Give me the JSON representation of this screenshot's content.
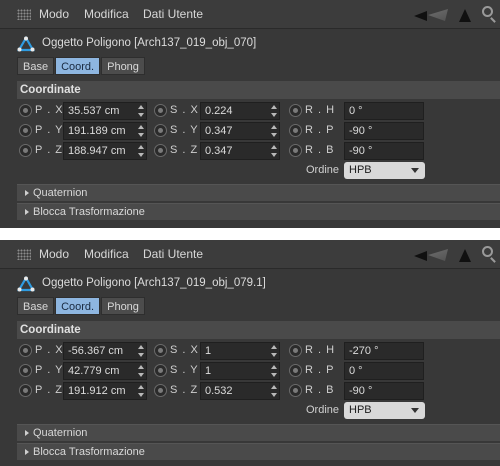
{
  "menubar": {
    "items": [
      "Modo",
      "Modifica",
      "Dati Utente"
    ]
  },
  "tabs": [
    "Base",
    "Coord.",
    "Phong"
  ],
  "active_tab": "Coord.",
  "section_title": "Coordinate",
  "order_label": "Ordine",
  "collapsibles": [
    "Quaternion",
    "Blocca Trasformazione"
  ],
  "colors": {
    "panel": "#383838",
    "active_tab": "#8eb6e0",
    "field": "#2a2a2a",
    "icon_accent": "#2e9be0"
  },
  "icons": [
    "grip-icon",
    "nav-back-icon",
    "nav-forward-icon",
    "nav-up-icon",
    "search-icon",
    "polygon-object-icon"
  ],
  "panels": [
    {
      "object_title": "Oggetto Poligono [Arch137_019_obj_070]",
      "rows": [
        {
          "p_label": "P . X",
          "p_value": "35.537 cm",
          "s_label": "S . X",
          "s_value": "0.224",
          "r_label": "R . H",
          "r_value": "0 °"
        },
        {
          "p_label": "P . Y",
          "p_value": "191.189 cm",
          "s_label": "S . Y",
          "s_value": "0.347",
          "r_label": "R . P",
          "r_value": "-90 °"
        },
        {
          "p_label": "P . Z",
          "p_value": "188.947 cm",
          "s_label": "S . Z",
          "s_value": "0.347",
          "r_label": "R . B",
          "r_value": "-90 °"
        }
      ],
      "order_value": "HPB"
    },
    {
      "object_title": "Oggetto Poligono [Arch137_019_obj_079.1]",
      "rows": [
        {
          "p_label": "P . X",
          "p_value": "-56.367 cm",
          "s_label": "S . X",
          "s_value": "1",
          "r_label": "R . H",
          "r_value": "-270 °"
        },
        {
          "p_label": "P . Y",
          "p_value": "42.779 cm",
          "s_label": "S . Y",
          "s_value": "1",
          "r_label": "R . P",
          "r_value": "0 °"
        },
        {
          "p_label": "P . Z",
          "p_value": "191.912 cm",
          "s_label": "S . Z",
          "s_value": "0.532",
          "r_label": "R . B",
          "r_value": "-90 °"
        }
      ],
      "order_value": "HPB"
    }
  ]
}
